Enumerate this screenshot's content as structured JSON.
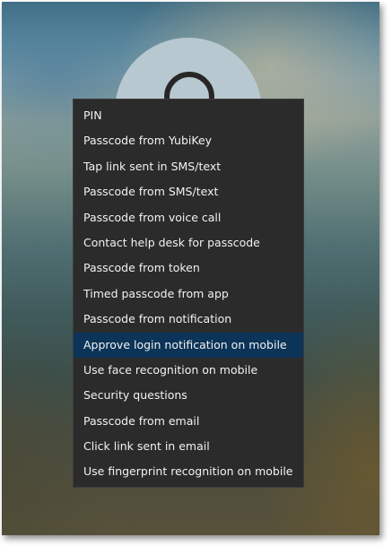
{
  "menu": {
    "selected_index": 9,
    "items": [
      {
        "label": "PIN"
      },
      {
        "label": "Passcode from YubiKey"
      },
      {
        "label": "Tap link sent in SMS/text"
      },
      {
        "label": "Passcode from SMS/text"
      },
      {
        "label": "Passcode from voice call"
      },
      {
        "label": "Contact help desk for passcode"
      },
      {
        "label": "Passcode from token"
      },
      {
        "label": "Timed passcode from app"
      },
      {
        "label": "Passcode from notification"
      },
      {
        "label": "Approve login notification on mobile"
      },
      {
        "label": "Use face recognition on mobile"
      },
      {
        "label": "Security questions"
      },
      {
        "label": "Passcode from email"
      },
      {
        "label": "Click link sent in email"
      },
      {
        "label": "Use fingerprint recognition on mobile"
      }
    ]
  },
  "colors": {
    "menu_background": "#2b2b2b",
    "menu_text": "#f2f2f2",
    "selected_background": "#0b3458"
  },
  "icons": {
    "avatar": "user-avatar-icon"
  }
}
